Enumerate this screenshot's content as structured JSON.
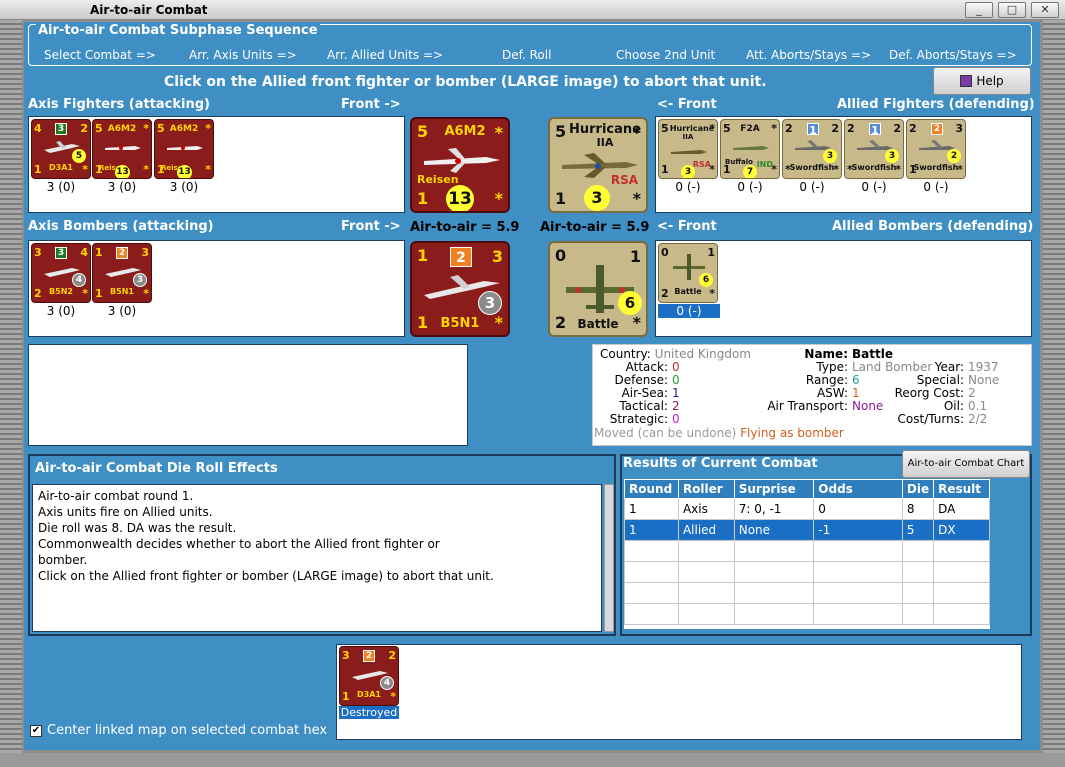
{
  "window": {
    "title": "Air-to-air Combat"
  },
  "sequence": {
    "title": "Air-to-air Combat Subphase Sequence",
    "steps": [
      "Select Combat =>",
      "Arr. Axis Units =>",
      "Arr. Allied Units =>",
      "Def. Roll",
      "Choose 2nd Unit",
      "Att. Aborts/Stays =>",
      "Def. Aborts/Stays =>"
    ]
  },
  "instruction": "Click on the Allied front fighter or bomber  (LARGE image) to abort that unit.",
  "help_label": "Help",
  "axis_fighters": {
    "title": "Axis Fighters (attacking)",
    "front_label": "Front ->",
    "units": [
      {
        "name": "D3A1",
        "tl": "4",
        "tr": "2",
        "bl": "1",
        "br": "*",
        "square": "3",
        "badge": "5",
        "count": "3 (0)"
      },
      {
        "name": "A6M2",
        "sub": "Reisen",
        "tl": "5",
        "tr": "*",
        "bl": "1",
        "br": "*",
        "badge": "13",
        "count": "3 (0)"
      },
      {
        "name": "A6M2",
        "sub": "Reisen",
        "tl": "5",
        "tr": "*",
        "bl": "1",
        "br": "*",
        "badge": "13",
        "count": "3 (0)"
      }
    ]
  },
  "axis_bombers": {
    "title": "Axis Bombers (attacking)",
    "front_label": "Front ->",
    "units": [
      {
        "name": "B5N2",
        "tl": "3",
        "tr": "4",
        "bl": "2",
        "br": "*",
        "square": "3",
        "badge": "4",
        "count": "3 (0)"
      },
      {
        "name": "B5N1",
        "tl": "1",
        "tr": "3",
        "bl": "1",
        "br": "*",
        "square": "2",
        "badge": "3",
        "count": "3 (0)"
      }
    ]
  },
  "front_axis_fighter": {
    "name": "A6M2",
    "sub": "Reisen",
    "tl": "5",
    "tr": "*",
    "bl": "1",
    "br": "*",
    "badge": "13"
  },
  "front_axis_bomber": {
    "name": "B5N1",
    "tl": "1",
    "tr": "3",
    "bl": "1",
    "br": "*",
    "square": "2",
    "badge": "3"
  },
  "front_allied_fighter": {
    "name": "Hurricane",
    "sub": "IIA",
    "nation": "RSA",
    "tl": "5",
    "tr": "*",
    "bl": "1",
    "br": "*",
    "badge": "3"
  },
  "front_allied_bomber": {
    "name": "Battle",
    "tl": "0",
    "tr": "1",
    "bl": "2",
    "br": "*",
    "badge": "6"
  },
  "air_to_air_axis": "Air-to-air = 5.9",
  "air_to_air_allied": "Air-to-air = 5.9",
  "allied_fighters": {
    "title": "Allied Fighters (defending)",
    "front_label": "<- Front",
    "units": [
      {
        "name": "Hurricane",
        "sub": "IIA",
        "nation": "RSA",
        "tl": "5",
        "tr": "*",
        "bl": "1",
        "br": "*",
        "badge": "3",
        "count": "0 (-)"
      },
      {
        "name": "Buffalo",
        "top": "F2A",
        "nation": "IND",
        "tl": "5",
        "tr": "*",
        "bl": "1",
        "br": "*",
        "badge": "7",
        "count": "0 (-)"
      },
      {
        "name": "Swordfish",
        "tl": "2",
        "tr": "2",
        "bl": "*",
        "br": "*",
        "square": "1",
        "badge": "3",
        "count": "0 (-)"
      },
      {
        "name": "Swordfish",
        "tl": "2",
        "tr": "2",
        "bl": "*",
        "br": "*",
        "square": "1",
        "badge": "3",
        "count": "0 (-)"
      },
      {
        "name": "Swordfish",
        "tl": "2",
        "tr": "3",
        "bl": "1",
        "br": "*",
        "square": "2",
        "badge": "2",
        "count": "0 (-)"
      }
    ]
  },
  "allied_bombers": {
    "title": "Allied Bombers (defending)",
    "front_label": "<- Front",
    "units": [
      {
        "name": "Battle",
        "tl": "0",
        "tr": "1",
        "bl": "2",
        "br": "*",
        "badge": "6",
        "count": "0 (-)"
      }
    ]
  },
  "unit_info": {
    "country_label": "Country:",
    "country": "United Kingdom",
    "attack_label": "Attack:",
    "attack": "0",
    "defense_label": "Defense:",
    "defense": "0",
    "airsea_label": "Air-Sea:",
    "airsea": "1",
    "tactical_label": "Tactical:",
    "tactical": "2",
    "strategic_label": "Strategic:",
    "strategic": "0",
    "name_label": "Name:",
    "name": "Battle",
    "type_label": "Type:",
    "type": "Land Bomber",
    "range_label": "Range:",
    "range": "6",
    "asw_label": "ASW:",
    "asw": "1",
    "transport_label": "Air Transport:",
    "transport": "None",
    "year_label": "Year:",
    "year": "1937",
    "special_label": "Special:",
    "special": "None",
    "reorg_label": "Reorg Cost:",
    "reorg": "2",
    "oil_label": "Oil:",
    "oil": "0.1",
    "cost_label": "Cost/Turns:",
    "cost": "2/2",
    "moved": "Moved (can be undone)",
    "flying": "Flying as bomber"
  },
  "effects": {
    "title": "Air-to-air Combat Die Roll Effects",
    "lines": [
      "Air-to-air combat round 1.",
      "Axis units fire on Allied units.",
      "Die roll was 8.  DA was the result.",
      "Commonwealth decides whether to abort the Allied front fighter or",
      "bomber.",
      "Click on the Allied front fighter or bomber  (LARGE image) to abort that unit."
    ]
  },
  "results": {
    "title": "Results of Current Combat",
    "chart_button": "Air-to-air Combat Chart",
    "columns": [
      "Round",
      "Roller",
      "Surprise",
      "Odds",
      "Die",
      "Result"
    ],
    "rows": [
      [
        "1",
        "Axis",
        "7: 0, -1",
        "0",
        "8",
        "DA"
      ],
      [
        "1",
        "Allied",
        "None",
        "-1",
        "5",
        "DX"
      ]
    ]
  },
  "destroyed": {
    "unit": {
      "name": "D3A1",
      "tl": "3",
      "tr": "2",
      "bl": "1",
      "br": "*",
      "square": "2",
      "badge": "4"
    },
    "label": "Destroyed"
  },
  "center_map": {
    "label": "Center linked map on selected combat hex",
    "checked": true
  },
  "colors": {
    "panel_blue": "#3f8fc5",
    "axis_red": "#8a1c1c",
    "allied_camo": "#c8b98a",
    "select_blue": "#1a6fc5"
  }
}
